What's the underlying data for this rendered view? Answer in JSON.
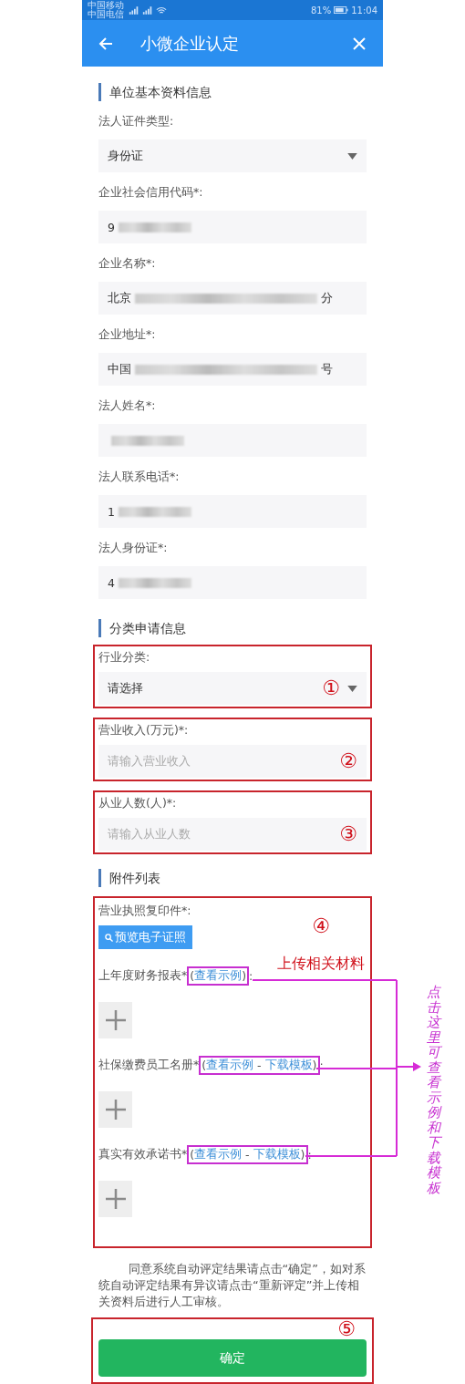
{
  "status_bar": {
    "carrier_1": "中国移动",
    "carrier_2": "中国电信",
    "battery": "81%",
    "time": "11:04"
  },
  "header": {
    "title": "小微企业认定"
  },
  "basic": {
    "title": "单位基本资料信息",
    "fields": [
      {
        "label": "法人证件类型:",
        "kind": "select",
        "value": "身份证"
      },
      {
        "label": "企业社会信用代码*:",
        "kind": "text",
        "value": "9",
        "redacted": true
      },
      {
        "label": "企业名称*:",
        "kind": "text",
        "value": "北京",
        "value_end": "分",
        "redacted": true
      },
      {
        "label": "企业地址*:",
        "kind": "text",
        "value": "中国",
        "value_end": "号",
        "redacted": true
      },
      {
        "label": "法人姓名*:",
        "kind": "text",
        "redacted": true
      },
      {
        "label": "法人联系电话*:",
        "kind": "text",
        "value": "1",
        "redacted": true
      },
      {
        "label": "法人身份证*:",
        "kind": "text",
        "value": "4",
        "redacted": true
      }
    ]
  },
  "classification": {
    "title": "分类申请信息",
    "fields": [
      {
        "label": "行业分类:",
        "kind": "select",
        "value": "请选择",
        "annotation": "①"
      },
      {
        "label": "营业收入(万元)*:",
        "kind": "text",
        "placeholder": "请输入营业收入",
        "annotation": "②"
      },
      {
        "label": "从业人数(人)*:",
        "kind": "text",
        "placeholder": "请输入从业人数",
        "annotation": "③"
      }
    ]
  },
  "attachments": {
    "title": "附件列表",
    "annotation": "④",
    "note": "上传相关材料",
    "license": {
      "label": "营业执照复印件*:",
      "button": "预览电子证照"
    },
    "uploads": [
      {
        "label": "上年度财务报表*",
        "parts": [
          {
            "kind": "plain",
            "text": "("
          },
          {
            "kind": "link",
            "text": "查看示例"
          },
          {
            "kind": "plain",
            "text": ")"
          }
        ],
        "suffix": ":",
        "highlighted": true
      },
      {
        "label": "社保缴费员工名册*",
        "parts": [
          {
            "kind": "plain",
            "text": "("
          },
          {
            "kind": "link",
            "text": "查看示例"
          },
          {
            "kind": "plain",
            "text": " - "
          },
          {
            "kind": "link",
            "text": "下载模板"
          },
          {
            "kind": "plain",
            "text": ")"
          }
        ],
        "suffix": ":",
        "highlighted": true
      },
      {
        "label": "真实有效承诺书*",
        "parts": [
          {
            "kind": "plain",
            "text": "("
          },
          {
            "kind": "link",
            "text": "查看示例"
          },
          {
            "kind": "plain",
            "text": " - "
          },
          {
            "kind": "link",
            "text": "下载模板"
          },
          {
            "kind": "plain",
            "text": ")"
          }
        ],
        "suffix": ":",
        "highlighted": true
      }
    ]
  },
  "callout": {
    "text": "点击这里可查看示例和下载模板"
  },
  "footer": {
    "notice": "同意系统自动评定结果请点击“确定”，如对系统自动评定结果有异议请点击“重新评定”并上传相关资料后进行人工审核。",
    "confirm": "确定",
    "annotation": "⑤"
  }
}
